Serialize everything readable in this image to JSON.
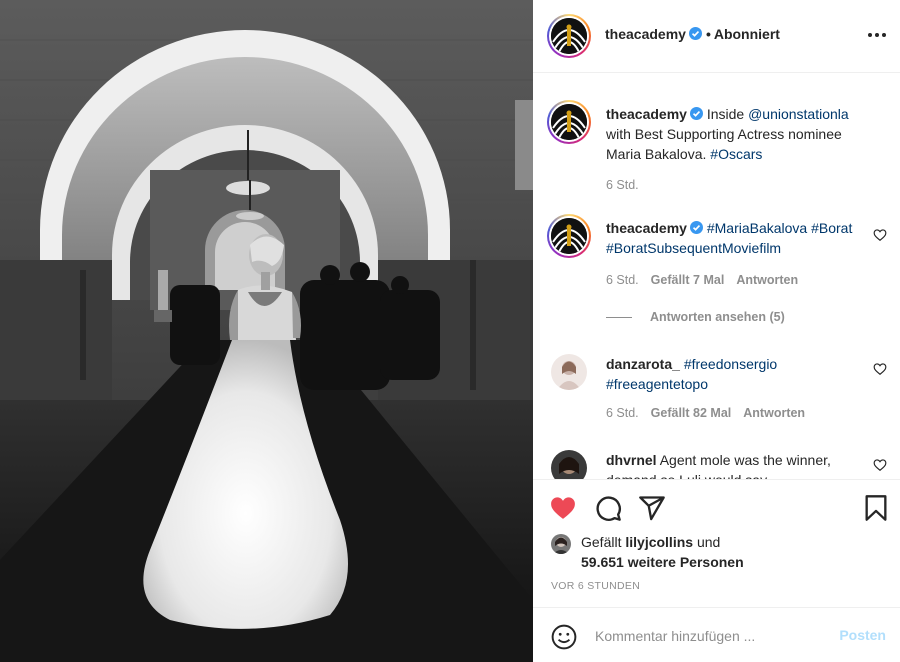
{
  "post": {
    "author": "theacademy",
    "follow_status": "Abonniert",
    "dot": "•",
    "image_alt": "Schwarzweißfoto: Frau im weißen Tüllkleid im Bogengang der Union Station"
  },
  "comments": [
    {
      "user": "theacademy",
      "verified": true,
      "text_parts": [
        "Inside ",
        "@unionstationla",
        " with Best Supporting Actress nominee Maria Bakalova. ",
        "#Oscars"
      ],
      "time": "6 Std."
    },
    {
      "user": "theacademy",
      "verified": true,
      "text_parts": [
        "#MariaBakalova",
        " ",
        "#Borat",
        " ",
        "#BoratSubsequentMoviefilm"
      ],
      "time": "6 Std.",
      "likes": "Gefällt 7 Mal",
      "reply": "Antworten",
      "view_replies": "Antworten ansehen (5)"
    },
    {
      "user": "danzarota_",
      "text_parts": [
        "#freedonsergio",
        " ",
        "#freeagentetopo"
      ],
      "time": "6 Std.",
      "likes": "Gefällt 82 Mal",
      "reply": "Antworten"
    },
    {
      "user": "dhvrnel",
      "text_parts": [
        "Agent mole was the winner, demand so Luli would say"
      ]
    }
  ],
  "likes": {
    "prefix": "Gefällt ",
    "user": "lilyjcollins",
    "mid": " und",
    "count_text": "59.651 weitere Personen"
  },
  "timestamp": "VOR 6 STUNDEN",
  "composer": {
    "placeholder": "Kommentar hinzufügen ...",
    "post_label": "Posten"
  },
  "colors": {
    "like_red": "#ed4956",
    "link_blue": "#00376b",
    "verified_blue": "#3897f0",
    "muted_gray": "#8e8e8e",
    "post_disabled": "#b2dffc"
  },
  "icons": [
    "heart-icon",
    "comment-icon",
    "share-icon",
    "bookmark-icon",
    "emoji-icon",
    "more-icon",
    "verified-icon"
  ]
}
